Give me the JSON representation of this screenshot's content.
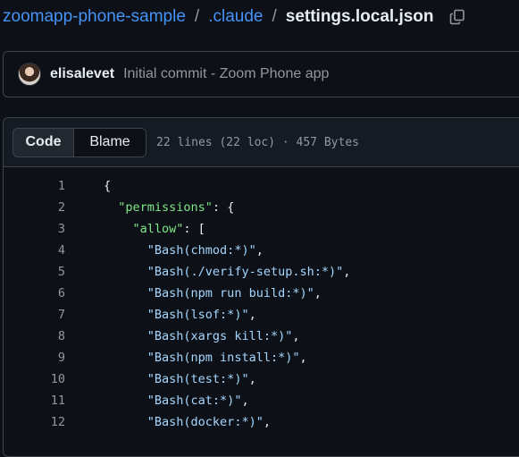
{
  "breadcrumb": {
    "repo": "zoomapp-phone-sample",
    "separator": "/",
    "folder": ".claude",
    "file": "settings.local.json"
  },
  "icons": {
    "copy": "copy-icon",
    "avatar": "user-avatar"
  },
  "commit": {
    "author": "elisalevet",
    "message": "Initial commit - Zoom Phone app"
  },
  "file_header": {
    "tabs": [
      "Code",
      "Blame"
    ],
    "selected_tab": "Code",
    "meta": "22 lines (22 loc) · 457 Bytes"
  },
  "code": {
    "lines": [
      {
        "n": "1",
        "indent": "",
        "parts": [
          {
            "t": "{",
            "c": ""
          }
        ]
      },
      {
        "n": "2",
        "indent": "  ",
        "parts": [
          {
            "t": "\"permissions\"",
            "c": "key"
          },
          {
            "t": ": {",
            "c": ""
          }
        ]
      },
      {
        "n": "3",
        "indent": "    ",
        "parts": [
          {
            "t": "\"allow\"",
            "c": "key"
          },
          {
            "t": ": [",
            "c": ""
          }
        ]
      },
      {
        "n": "4",
        "indent": "      ",
        "parts": [
          {
            "t": "\"Bash(chmod:*)\"",
            "c": "str"
          },
          {
            "t": ",",
            "c": ""
          }
        ]
      },
      {
        "n": "5",
        "indent": "      ",
        "parts": [
          {
            "t": "\"Bash(./verify-setup.sh:*)\"",
            "c": "str"
          },
          {
            "t": ",",
            "c": ""
          }
        ]
      },
      {
        "n": "6",
        "indent": "      ",
        "parts": [
          {
            "t": "\"Bash(npm run build:*)\"",
            "c": "str"
          },
          {
            "t": ",",
            "c": ""
          }
        ]
      },
      {
        "n": "7",
        "indent": "      ",
        "parts": [
          {
            "t": "\"Bash(lsof:*)\"",
            "c": "str"
          },
          {
            "t": ",",
            "c": ""
          }
        ]
      },
      {
        "n": "8",
        "indent": "      ",
        "parts": [
          {
            "t": "\"Bash(xargs kill:*)\"",
            "c": "str"
          },
          {
            "t": ",",
            "c": ""
          }
        ]
      },
      {
        "n": "9",
        "indent": "      ",
        "parts": [
          {
            "t": "\"Bash(npm install:*)\"",
            "c": "str"
          },
          {
            "t": ",",
            "c": ""
          }
        ]
      },
      {
        "n": "10",
        "indent": "      ",
        "parts": [
          {
            "t": "\"Bash(test:*)\"",
            "c": "str"
          },
          {
            "t": ",",
            "c": ""
          }
        ]
      },
      {
        "n": "11",
        "indent": "      ",
        "parts": [
          {
            "t": "\"Bash(cat:*)\"",
            "c": "str"
          },
          {
            "t": ",",
            "c": ""
          }
        ]
      },
      {
        "n": "12",
        "indent": "      ",
        "parts": [
          {
            "t": "\"Bash(docker:*)\"",
            "c": "str"
          },
          {
            "t": ",",
            "c": ""
          }
        ]
      }
    ]
  },
  "colors": {
    "background": "#0d1117",
    "link": "#4493f8",
    "json_key": "#7ee787",
    "json_string": "#a5d6ff",
    "muted_text": "#9198a1",
    "border": "#3d444d"
  }
}
